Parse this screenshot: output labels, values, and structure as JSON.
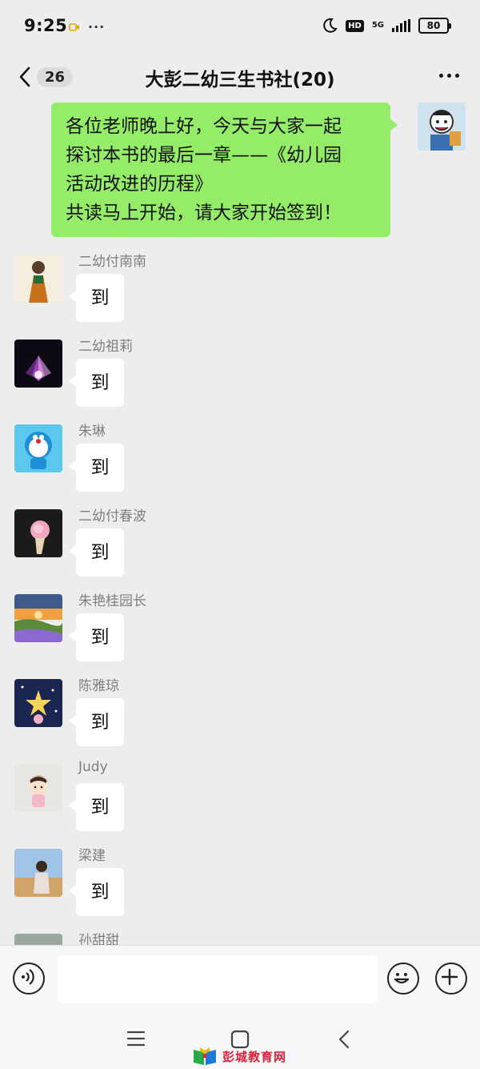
{
  "status": {
    "time": "9:25",
    "extra": "···",
    "network": "5G",
    "hd": "HD",
    "battery": "80"
  },
  "header": {
    "unread_count": "26",
    "title": "大彭二幼三生书社(20)"
  },
  "my_message": {
    "lines": [
      "各位老师晚上好，今天与大家一起",
      "探讨本书的最后一章——《幼儿园",
      "活动改进的历程》",
      "共读马上开始，请大家开始签到！"
    ]
  },
  "messages": [
    {
      "sender": "二幼付南南",
      "text": "到"
    },
    {
      "sender": "二幼祖莉",
      "text": "到"
    },
    {
      "sender": "朱琳",
      "text": "到"
    },
    {
      "sender": "二幼付春波",
      "text": "到"
    },
    {
      "sender": "朱艳桂园长",
      "text": "到"
    },
    {
      "sender": "陈雅琼",
      "text": "到"
    },
    {
      "sender": "Judy",
      "text": "到"
    },
    {
      "sender": "梁建",
      "text": "到"
    },
    {
      "sender": "孙甜甜",
      "text": ""
    }
  ],
  "watermark": "彭城教育网"
}
